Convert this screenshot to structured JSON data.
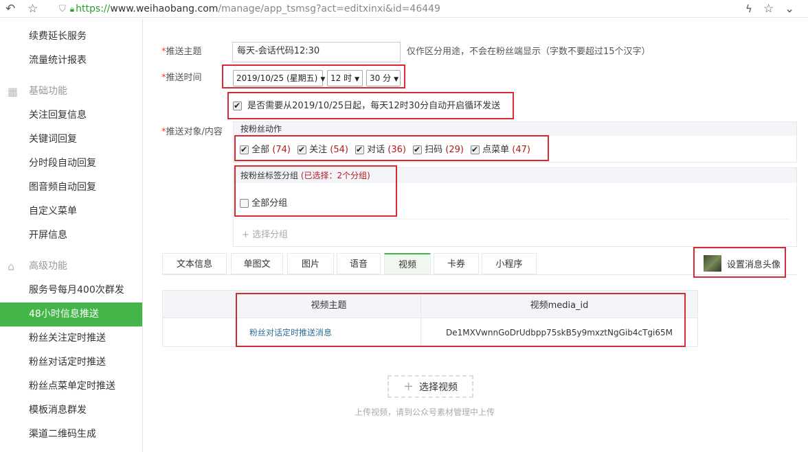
{
  "browser": {
    "url_scheme": "https://",
    "url_host": "www.weihaobang.com",
    "url_path": "/manage/app_tsmsg?act=editxinxi&id=46449"
  },
  "sidebar": {
    "items_top": [
      "续费延长服务",
      "流量统计报表"
    ],
    "group_basic": "基础功能",
    "items_basic": [
      "关注回复信息",
      "关键词回复",
      "分时段自动回复",
      "图音频自动回复",
      "自定义菜单",
      "开屏信息"
    ],
    "group_advanced": "高级功能",
    "items_advanced": [
      "服务号每月400次群发",
      "48小时信息推送",
      "粉丝关注定时推送",
      "粉丝对话定时推送",
      "粉丝点菜单定时推送",
      "模板消息群发",
      "渠道二维码生成"
    ],
    "active_item": "48小时信息推送"
  },
  "form": {
    "subject_label": "推送主题",
    "subject_value": "每天-会话代码12:30",
    "subject_hint": "仅作区分用途，不会在粉丝端显示（字数不要超过15个汉字）",
    "time_label": "推送时间",
    "date_value": "2019/10/25 (星期五)",
    "hour_value": "12 时",
    "minute_value": "30 分",
    "loop_text": "是否需要从2019/10/25日起，每天12时30分自动开启循环发送",
    "target_label": "推送对象/内容",
    "action_panel_title": "按粉丝动作",
    "actions": [
      {
        "name": "全部",
        "count": "(74)"
      },
      {
        "name": "关注",
        "count": "(54)"
      },
      {
        "name": "对话",
        "count": "(36)"
      },
      {
        "name": "扫码",
        "count": "(29)"
      },
      {
        "name": "点菜单",
        "count": "(47)"
      }
    ],
    "tag_panel_title": "按粉丝标签分组",
    "tag_selected": "(已选择：2个分组)",
    "all_groups": "全部分组",
    "choose_group": "+ 选择分组"
  },
  "tabs": [
    "文本信息",
    "单图文",
    "图片",
    "语音",
    "视频",
    "卡券",
    "小程序"
  ],
  "active_tab": "视频",
  "avatar_button": "设置消息头像",
  "video_table": {
    "headers": [
      "视频主题",
      "视频media_id"
    ],
    "rows": [
      [
        "粉丝对话定时推送消息",
        "De1MXVwnnGoDrUdbpp75skB5y9mxztNgGib4cTgi65M"
      ]
    ]
  },
  "choose_video": "选择视频",
  "upload_hint": "上传视频，请到公众号素材管理中上传",
  "colors": {
    "accent": "#44b549",
    "highlight": "#d9282f",
    "count": "#b0181e"
  }
}
